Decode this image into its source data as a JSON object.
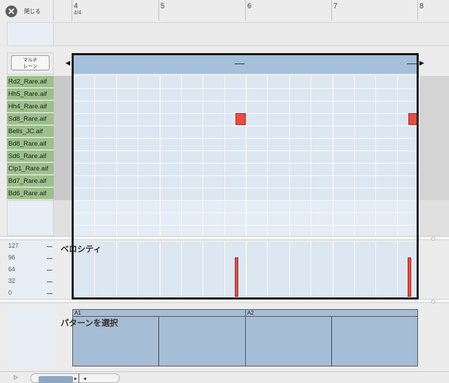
{
  "toolbar": {
    "close_label": "閉じる",
    "close_icon": "close-icon"
  },
  "ruler": {
    "bars": [
      "4",
      "5",
      "6",
      "7",
      "8"
    ],
    "time_signature": "4/4"
  },
  "lane": {
    "multilane_label": "マルチ\nレーン",
    "loop_start_dash": "—",
    "loop_end_dash": "—"
  },
  "tracks": [
    "Rd2_Rare.aif",
    "Hh5_Rare.aif",
    "Hh4_Rare.aif",
    "Sd8_Rare.aif",
    "Bells_JC.aif",
    "Bd8_Rare.aif",
    "Sd6_Rare.aif",
    "Clp1_Rare.aif",
    "Bd7_Rare.aif",
    "Bd6_Rare.aif"
  ],
  "notes": [
    {
      "track": "Sd8_Rare.aif",
      "bar": 5.875
    },
    {
      "track": "Sd8_Rare.aif",
      "bar": 7.875
    }
  ],
  "velocity": {
    "title": "ベロシティ",
    "scale": [
      "127",
      "96",
      "64",
      "32",
      "0"
    ],
    "values": [
      {
        "bar": 5.875,
        "value": 96
      },
      {
        "bar": 7.875,
        "value": 96
      }
    ]
  },
  "patterns": {
    "title": "パターンを選択",
    "items": [
      {
        "label": "A1"
      },
      {
        "label": "A2"
      }
    ]
  },
  "colors": {
    "note": "#ee4b3c",
    "track_bg": "#9cc08a",
    "loop_band": "#a4c0db",
    "pattern": "#a6bdd6"
  }
}
